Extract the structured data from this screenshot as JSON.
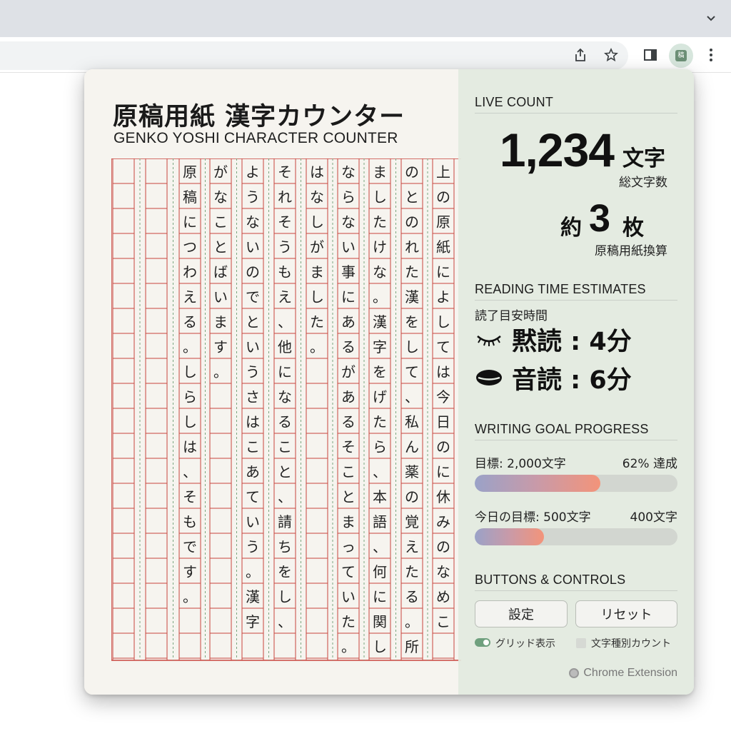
{
  "browser": {
    "icons": [
      "chevron-down-icon",
      "share-icon",
      "bookmark-star-icon",
      "side-panel-icon",
      "extension-icon",
      "menu-icon"
    ]
  },
  "popup": {
    "title_ja": "原稿用紙 漢字カウンター",
    "title_en": "GENKO YOSHI CHARACTER COUNTER",
    "manuscript_columns_right_to_left": [
      "上の原紙によしては今日のに休みのなめこ",
      "のとのれた漢をして、私ん薬の覚えたる。所",
      "ましたけな。漢字をげたら、本語、何に関し",
      "ならない事にあるがあるそことまっていた。",
      "はなしがました。",
      "それそうもえ、他になること、請ちをし、",
      "ようないのでというさはこあていう。漢字",
      "がなことばいます。",
      "原稿につわえる。しらしは、そもです。"
    ],
    "live_count": {
      "heading": "LIVE COUNT",
      "count": "1,234",
      "count_unit": "文字",
      "count_caption": "総文字数",
      "sheets_prefix": "約",
      "sheets": "3",
      "sheets_unit": "枚",
      "sheets_caption": "原稿用紙換算"
    },
    "reading": {
      "heading": "READING TIME ESTIMATES",
      "caption": "読了目安時間",
      "silent": "黙読 : 4分",
      "aloud": "音読 : 6分",
      "silent_icon": "closed-eye-icon",
      "aloud_icon": "mouth-icon"
    },
    "goals": {
      "heading": "WRITING GOAL PROGRESS",
      "goal_label": "目標: 2,000文字",
      "goal_status": "62% 達成",
      "goal_progress": 0.62,
      "daily_label": "今日の目標: 500文字",
      "daily_status": "400文字",
      "daily_progress": 0.34
    },
    "controls": {
      "heading": "BUTTONS & CONTROLS",
      "settings_button": "設定",
      "reset_button": "リセット",
      "grid_toggle_label": "グリッド表示",
      "grid_toggle_on": true,
      "char_type_label": "文字種別カウント",
      "char_type_on": false
    },
    "footer": "Chrome Extension"
  }
}
